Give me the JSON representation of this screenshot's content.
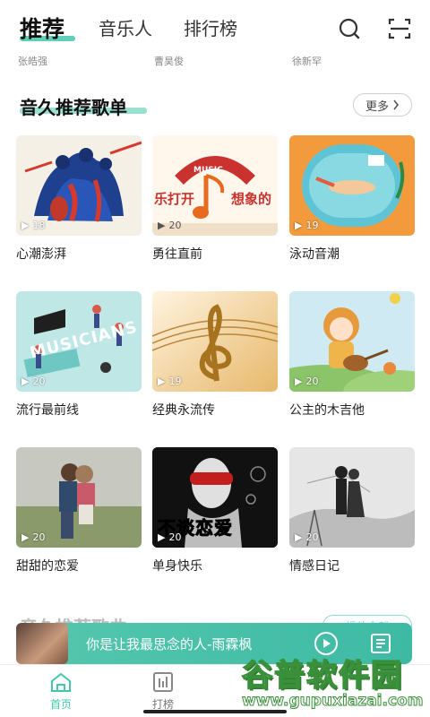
{
  "top_nav": {
    "tabs": [
      {
        "label": "推荐",
        "active": true
      },
      {
        "label": "音乐人",
        "active": false
      },
      {
        "label": "排行榜",
        "active": false
      }
    ],
    "icons": {
      "search": "search-icon",
      "scan": "scan-icon"
    }
  },
  "artists": [
    "张皓强",
    "曹昊俊",
    "徐新罕"
  ],
  "section": {
    "title": "音久推荐歌单",
    "more_label": "更多"
  },
  "playlists": [
    {
      "title": "心潮澎湃",
      "plays": "18",
      "cover": "jazz-band-illustration"
    },
    {
      "title": "勇往直前",
      "plays": "20",
      "cover": "music-note-banner",
      "cover_text_1": "MUSIC",
      "cover_text_2": "乐打开",
      "cover_text_3": "想象的"
    },
    {
      "title": "泳动音潮",
      "plays": "19",
      "cover": "swimming-illustration"
    },
    {
      "title": "流行最前线",
      "plays": "20",
      "cover": "musicians-illustration",
      "cover_text_1": "MUSICIANS"
    },
    {
      "title": "经典永流传",
      "plays": "19",
      "cover": "treble-clef-gold"
    },
    {
      "title": "公主的木吉他",
      "plays": "20",
      "cover": "girl-with-guitar"
    },
    {
      "title": "甜甜的恋爱",
      "plays": "20",
      "cover": "couple-photo"
    },
    {
      "title": "单身快乐",
      "plays": "20",
      "cover": "man-covering-eyes",
      "cover_text_1": "不谈恋爱"
    },
    {
      "title": "情感日记",
      "plays": "20",
      "cover": "couple-silhouette-sketch"
    }
  ],
  "section2": {
    "title": "音久推荐歌曲",
    "play_all_label": "播放全部"
  },
  "mini_player": {
    "title": "你是让我最思念的人-雨霖枫"
  },
  "bottom_nav": [
    {
      "label": "首页",
      "icon": "home-icon",
      "active": true
    },
    {
      "label": "打榜",
      "icon": "chart-icon",
      "active": false
    }
  ],
  "watermark": {
    "text_cn": "谷普软件园",
    "url": "www.gupuxiazai.com"
  },
  "colors": {
    "accent": "#43c7a8",
    "text": "#222222",
    "muted": "#888888"
  }
}
